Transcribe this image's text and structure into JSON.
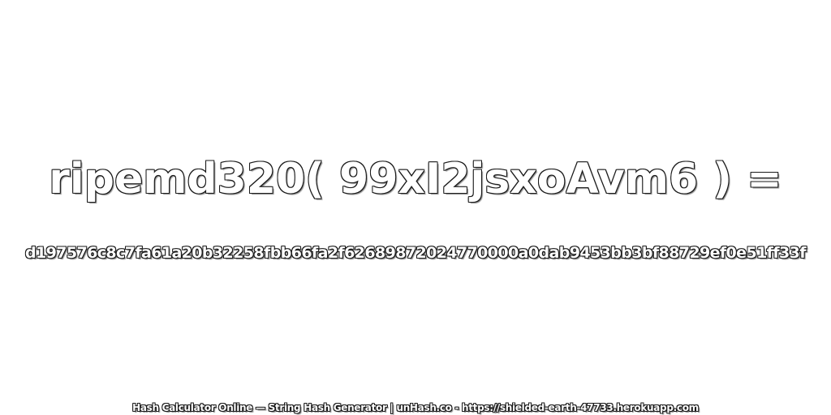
{
  "expression": "ripemd320( 99xI2jsxoAvm6 ) =",
  "hash_value": "d197576c8c7fa61a20b32258fbb66fa2f62689872024770000a0dab9453bb3bf88729ef0e51ff33f",
  "footer": "Hash Calculator Online — String Hash Generator | unHash.co - https://shielded-earth-47733.herokuapp.com",
  "colors": {
    "background": "#ffffff",
    "text_fill": "#ffffff",
    "text_outline": "#1a1a1a"
  }
}
